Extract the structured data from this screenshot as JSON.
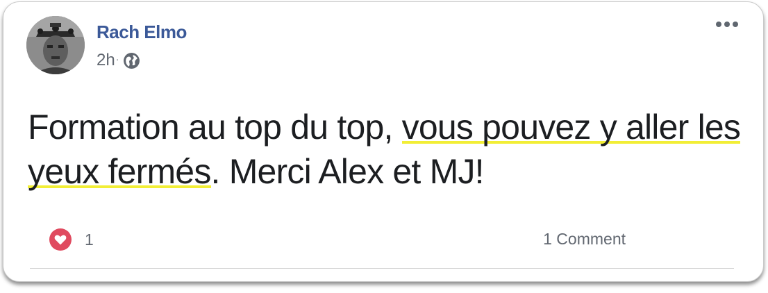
{
  "post": {
    "author": "Rach Elmo",
    "time": "2h",
    "separator": "·",
    "privacy_icon": "globe-icon",
    "more_icon": "more-options-icon",
    "text_segments": [
      {
        "text": "Formation au top du top, ",
        "highlight": false
      },
      {
        "text": "vous pouvez y aller les yeux fermés",
        "highlight": true
      },
      {
        "text": ". Merci Alex et MJ!",
        "highlight": false
      }
    ],
    "highlight_color": "#f2ee36"
  },
  "footer": {
    "reaction_icon": "heart-icon",
    "reaction_count": "1",
    "comments_label": "1 Comment"
  },
  "colors": {
    "author": "#3b5998",
    "meta": "#616770",
    "heart_badge": "#e04a5f"
  }
}
